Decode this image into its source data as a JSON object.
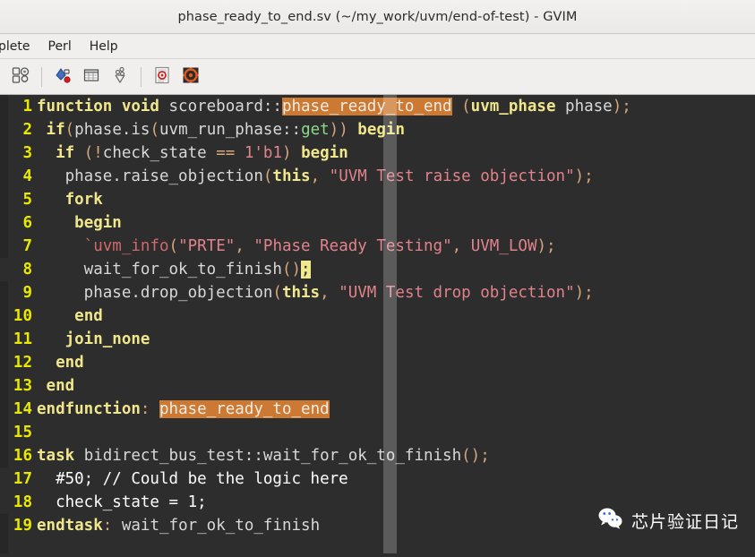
{
  "window": {
    "title": "phase_ready_to_end.sv (~/my_work/uvm/end-of-test) - GVIM"
  },
  "menubar": {
    "items": [
      {
        "label": "plete",
        "name": "menu-complete"
      },
      {
        "label": "Perl",
        "name": "menu-perl"
      },
      {
        "label": "Help",
        "name": "menu-help"
      }
    ]
  },
  "toolbar": {
    "buttons": [
      {
        "name": "make-icon",
        "title": "Make"
      },
      {
        "name": "syntax-color-icon",
        "title": "Syntax coloring"
      },
      {
        "name": "tag-list-icon",
        "title": "Tag list"
      },
      {
        "name": "tag-jump-icon",
        "title": "Jump to tag"
      },
      {
        "name": "help-page-icon",
        "title": "Help page"
      },
      {
        "name": "find-help-icon",
        "title": "Find help"
      }
    ]
  },
  "editor": {
    "filetype": "systemverilog",
    "cursor_line": 8,
    "selected_lines": [
      17,
      18
    ],
    "search_term": "phase_ready_to_end",
    "colors": {
      "background": "#2d2d2d",
      "linenumber": "#e8e800",
      "keyword": "#f0e68c",
      "string": "#e0838c",
      "function": "#8fd88f",
      "macro": "#cf6a6a",
      "search_highlight": "#cc7a33",
      "cursor": "#f0ea8c",
      "cursorline": "#6b6b6b",
      "selection": "#2a5fdc"
    },
    "lines": [
      {
        "n": "1",
        "text": "function void scoreboard::phase_ready_to_end (uvm_phase phase);"
      },
      {
        "n": "2",
        "text": " if(phase.is(uvm_run_phase::get)) begin"
      },
      {
        "n": "3",
        "text": "  if (!check_state == 1'b1) begin"
      },
      {
        "n": "4",
        "text": "   phase.raise_objection(this, \"UVM Test raise objection\");"
      },
      {
        "n": "5",
        "text": "   fork"
      },
      {
        "n": "6",
        "text": "    begin"
      },
      {
        "n": "7",
        "text": "     `uvm_info(\"PRTE\", \"Phase Ready Testing\", UVM_LOW);"
      },
      {
        "n": "8",
        "text": "     wait_for_ok_to_finish();"
      },
      {
        "n": "9",
        "text": "     phase.drop_objection(this, \"UVM Test drop objection\");"
      },
      {
        "n": "10",
        "text": "    end"
      },
      {
        "n": "11",
        "text": "   join_none"
      },
      {
        "n": "12",
        "text": "  end"
      },
      {
        "n": "13",
        "text": " end"
      },
      {
        "n": "14",
        "text": "endfunction: phase_ready_to_end"
      },
      {
        "n": "15",
        "text": ""
      },
      {
        "n": "16",
        "text": "task bidirect_bus_test::wait_for_ok_to_finish();"
      },
      {
        "n": "17",
        "text": "  #50; // Could be the logic here"
      },
      {
        "n": "18",
        "text": "  check_state = 1;"
      },
      {
        "n": "19",
        "text": "endtask: wait_for_ok_to_finish"
      }
    ]
  },
  "watermark": {
    "text": "芯片验证日记",
    "icon": "wechat-icon"
  }
}
